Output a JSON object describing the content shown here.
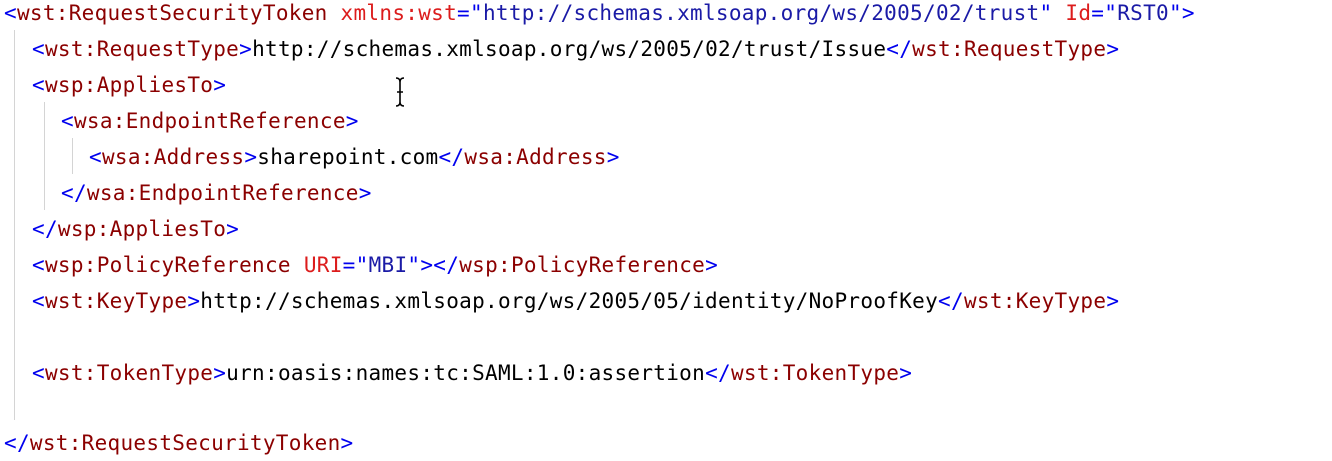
{
  "root": {
    "open_tag": "wst:RequestSecurityToken",
    "xmlns_attr": "xmlns:wst",
    "xmlns_value": "http://schemas.xmlsoap.org/ws/2005/02/trust",
    "id_attr": "Id",
    "id_value": "RST0",
    "close_tag": "wst:RequestSecurityToken"
  },
  "request_type": {
    "tag": "wst:RequestType",
    "value": "http://schemas.xmlsoap.org/ws/2005/02/trust/Issue"
  },
  "applies_to": {
    "tag": "wsp:AppliesTo",
    "endpoint_tag": "wsa:EndpointReference",
    "address_tag": "wsa:Address",
    "address_value": "sharepoint.com"
  },
  "policy_reference": {
    "tag": "wsp:PolicyReference",
    "uri_attr": "URI",
    "uri_value": "MBI"
  },
  "key_type": {
    "tag": "wst:KeyType",
    "value": "http://schemas.xmlsoap.org/ws/2005/05/identity/NoProofKey"
  },
  "token_type": {
    "tag": "wst:TokenType",
    "value": "urn:oasis:names:tc:SAML:1.0:assertion"
  },
  "colors": {
    "bracket": "#0000ee",
    "tag_name": "#8b0000",
    "attribute": "#dc1c1c",
    "attribute_value": "#1a1aa6",
    "text": "#000000"
  },
  "icons": {
    "cursor": "text-cursor-icon"
  }
}
